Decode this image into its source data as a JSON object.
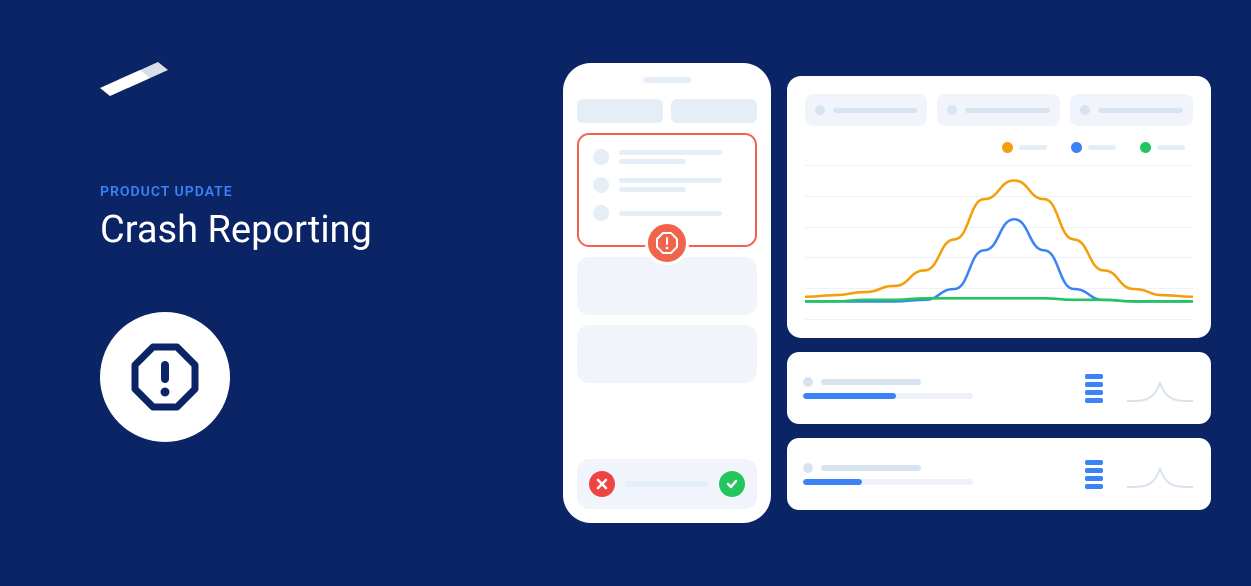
{
  "eyebrow": "PRODUCT UPDATE",
  "title": "Crash Reporting",
  "colors": {
    "background": "#0a2466",
    "accent_blue": "#3b82f6",
    "accent_orange": "#f59e0b",
    "accent_green": "#22c55e",
    "error": "#f2634c"
  },
  "chart_data": {
    "type": "line",
    "legend": [
      {
        "color": "#f59e0b"
      },
      {
        "color": "#3b82f6"
      },
      {
        "color": "#22c55e"
      }
    ],
    "series": [
      {
        "name": "orange",
        "color": "#f59e0b",
        "values": [
          85,
          84,
          82,
          78,
          68,
          48,
          22,
          10,
          22,
          48,
          68,
          80,
          84,
          85
        ]
      },
      {
        "name": "blue",
        "color": "#3b82f6",
        "values": [
          88,
          88,
          88,
          88,
          87,
          80,
          55,
          35,
          55,
          80,
          87,
          88,
          88,
          88
        ]
      },
      {
        "name": "green",
        "color": "#22c55e",
        "values": [
          88,
          88,
          87,
          87,
          86,
          86,
          86,
          86,
          86,
          87,
          87,
          88,
          88,
          88
        ]
      }
    ]
  },
  "list_rows": [
    {
      "progress": 55
    },
    {
      "progress": 35
    }
  ]
}
